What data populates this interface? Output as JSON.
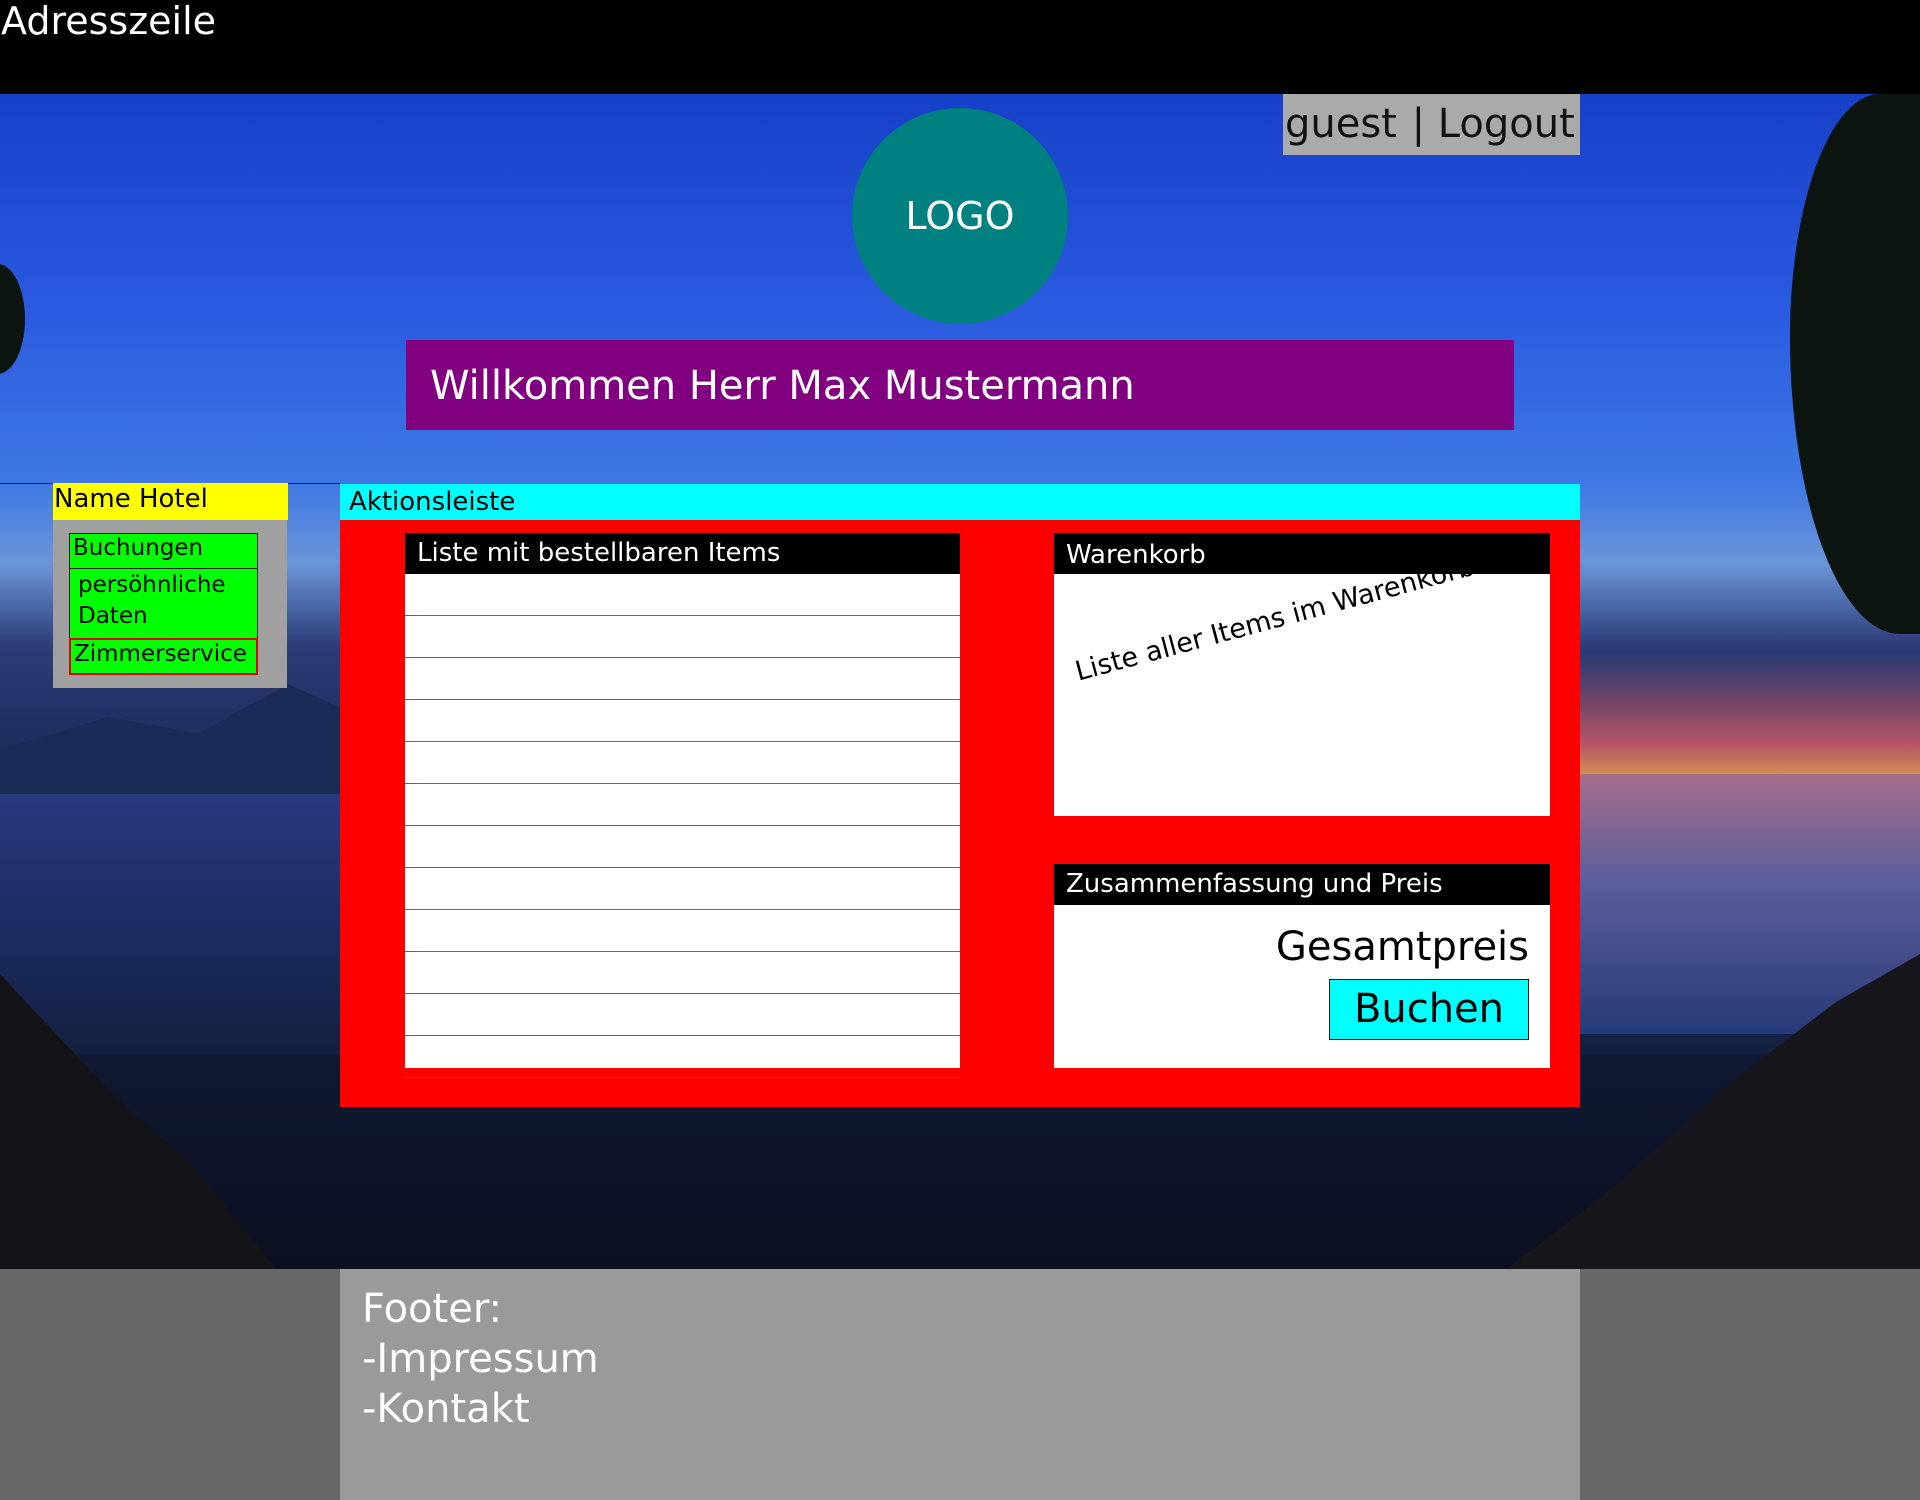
{
  "address_bar": {
    "label": "Adresszeile"
  },
  "header": {
    "user": "guest",
    "separator": "|",
    "logout": "Logout",
    "logo": "LOGO",
    "welcome": "Willkommen Herr Max Mustermann"
  },
  "sidebar": {
    "hotel_name": "Name Hotel",
    "items": [
      {
        "label": "Buchungen"
      },
      {
        "label": "persöhnliche Daten"
      },
      {
        "label": "Zimmerservice",
        "active": true
      }
    ]
  },
  "action_bar": {
    "label": "Aktionsleiste"
  },
  "items_list": {
    "title": "Liste mit bestellbaren Items",
    "rows": [
      "",
      "",
      "",
      "",
      "",
      "",
      "",
      "",
      "",
      "",
      "",
      ""
    ]
  },
  "cart": {
    "title": "Warenkorb",
    "placeholder": "Liste aller Items im Warenkorb"
  },
  "summary": {
    "title": "Zusammenfassung und Preis",
    "total_label": "Gesamtpreis",
    "book_button": "Buchen"
  },
  "footer": {
    "heading": "Footer:",
    "links": [
      "-Impressum",
      "-Kontakt"
    ]
  },
  "colors": {
    "accent_purple": "#800080",
    "logo_teal": "#008080",
    "action_cyan": "#00ffff",
    "panel_red": "#ff0000",
    "nav_green": "#00ff00",
    "hotel_yellow": "#ffff00"
  }
}
